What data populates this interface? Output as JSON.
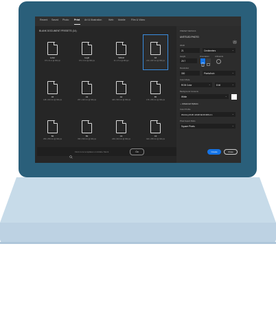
{
  "app": {
    "tabs": [
      {
        "label": "Recent",
        "active": false
      },
      {
        "label": "Saved",
        "active": false
      },
      {
        "label": "Photo",
        "active": false
      },
      {
        "label": "Print",
        "active": true
      },
      {
        "label": "Art & Illustration",
        "active": false
      },
      {
        "label": "Web",
        "active": false
      },
      {
        "label": "Mobile",
        "active": false
      },
      {
        "label": "Film & Video",
        "active": false
      }
    ]
  },
  "presets": {
    "section_title": "BLANK DOCUMENT PRESETS (14)",
    "items": [
      {
        "name": "Letter",
        "size": "8.5 x 11 in @ 300 ppi"
      },
      {
        "name": "Legal",
        "size": "8.5 x 14 in @ 300 ppi"
      },
      {
        "name": "Tabloid",
        "size": "11 x 17 in @ 300 ppi"
      },
      {
        "name": "A4",
        "size": "210 x 297 mm @ 300 ppi",
        "selected": true
      },
      {
        "name": "A5",
        "size": "148 x 210 mm @ 300 ppi"
      },
      {
        "name": "A3",
        "size": "297 x 420 mm @ 300 ppi"
      },
      {
        "name": "A2",
        "size": "420 x 594 mm @ 300 ppi"
      },
      {
        "name": "B5",
        "size": "176 x 250 mm @ 300 ppi"
      },
      {
        "name": "B4",
        "size": "250 x 353 mm @ 300 ppi"
      },
      {
        "name": "B3",
        "size": "353 x 500 mm @ 300 ppi"
      },
      {
        "name": "C4",
        "size": "229 x 324 mm @ 300 ppi"
      },
      {
        "name": "C3",
        "size": "324 x 458 mm @ 300 ppi"
      }
    ]
  },
  "search": {
    "placeholder": "Find more templates on Adobe Stock",
    "go_label": "Go"
  },
  "details": {
    "header": "PRESET DETAILS",
    "doc_name": "UNTITLED PHOTO",
    "width_label": "Width",
    "width_value": "21",
    "width_unit": "Centimeters",
    "height_label": "Height",
    "height_value": "29.7",
    "orientation_label": "Orientation",
    "artboards_label": "Artboards",
    "resolution_label": "Resolution",
    "resolution_value": "300",
    "resolution_unit": "Pixels/Inch",
    "color_mode_label": "Color Mode",
    "color_mode_value": "RGB Color",
    "bit_depth": "8 bit",
    "background_label": "Background Contents",
    "background_value": "White",
    "background_swatch": "#ffffff",
    "advanced_label": "Advanced Options",
    "color_profile_label": "Color Profile",
    "color_profile_value": "Working RGB: sRGB IEC61966-2.1",
    "pixel_aspect_label": "Pixel Aspect Ratio",
    "pixel_aspect_value": "Square Pixels",
    "create_label": "Create",
    "close_label": "Close"
  },
  "colors": {
    "laptop_lid": "#2a5f7a",
    "laptop_base": "#c7dbe9",
    "accent": "#1473e6"
  }
}
